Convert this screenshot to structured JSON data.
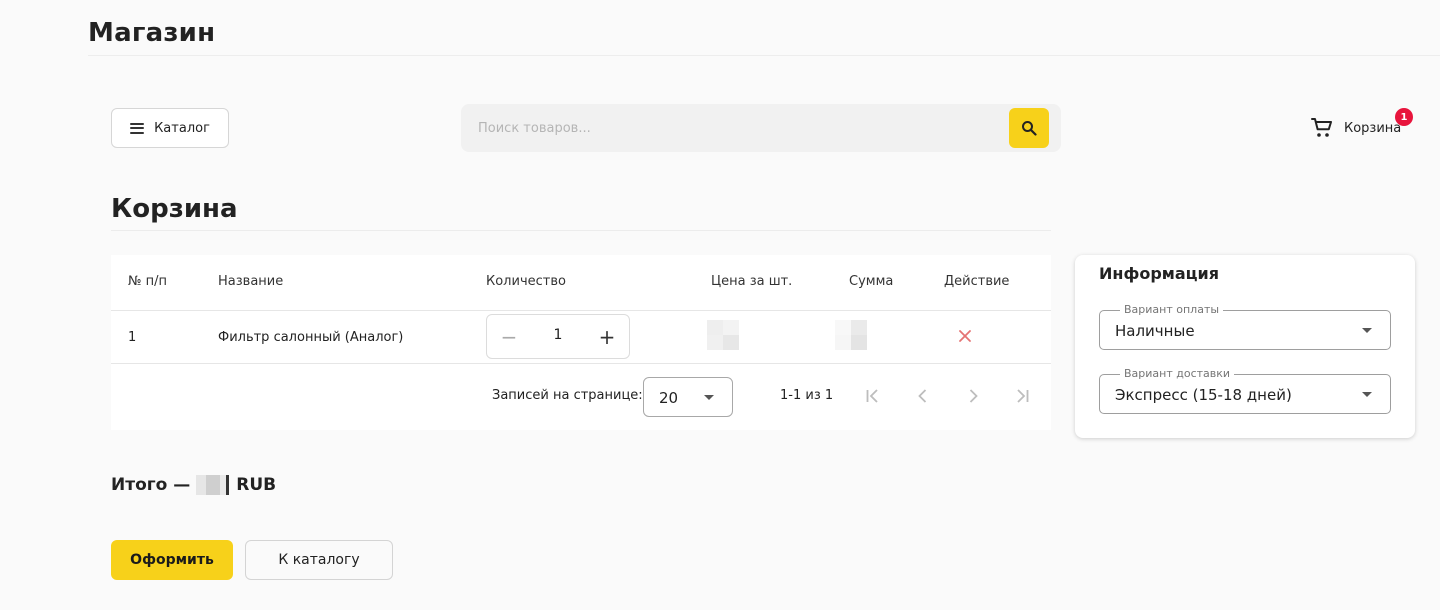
{
  "app": {
    "title": "Магазин"
  },
  "header": {
    "catalog_label": "Каталог",
    "search_placeholder": "Поиск товаров...",
    "cart_label": "Корзина",
    "cart_count": "1"
  },
  "page": {
    "title": "Корзина"
  },
  "table": {
    "columns": [
      "№ п/п",
      "Название",
      "Количество",
      "Цена за шт.",
      "Сумма",
      "Действие"
    ],
    "rows": [
      {
        "index": "1",
        "name": "Фильтр салонный (Аналог)",
        "quantity": "1",
        "qty_minus": "−",
        "qty_plus": "+"
      }
    ],
    "pagination": {
      "rows_per_page_label": "Записей на странице:",
      "rows_per_page": "20",
      "range": "1-1 из 1"
    }
  },
  "info": {
    "title": "Информация",
    "payment": {
      "label": "Вариант оплаты",
      "value": "Наличные"
    },
    "delivery": {
      "label": "Вариант доставки",
      "value": "Экспресс (15-18 дней)"
    }
  },
  "total": {
    "prefix": "Итого —",
    "currency": "RUB"
  },
  "actions": {
    "checkout_label": "Оформить",
    "back_label": "К каталогу"
  },
  "colors": {
    "accent": "#f7d11a",
    "badge": "#e8143c",
    "delete": "#e57373"
  },
  "icons": {
    "catalog": "menu-icon",
    "search": "search-icon",
    "cart": "cart-icon",
    "delete": "close-icon",
    "select": "chevron-down-icon"
  }
}
